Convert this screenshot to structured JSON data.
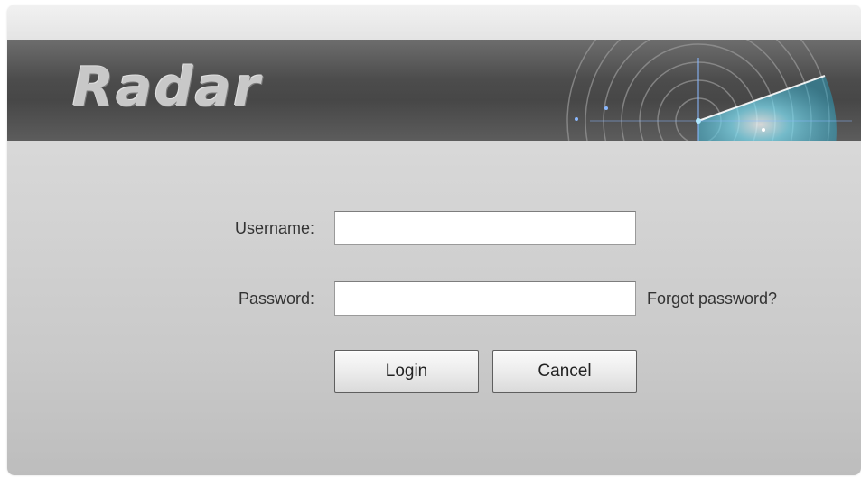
{
  "banner": {
    "title": "Radar",
    "logo_icon": "radar-sweep-icon"
  },
  "form": {
    "username_label": "Username:",
    "username_value": "",
    "password_label": "Password:",
    "password_value": "",
    "forgot_password_label": "Forgot password?",
    "login_label": "Login",
    "cancel_label": "Cancel"
  },
  "colors": {
    "banner_dark": "#4c4c4c",
    "dialog_bg": "#d3d3d3",
    "radar_accent": "#5fd0e8",
    "text": "#333333"
  }
}
